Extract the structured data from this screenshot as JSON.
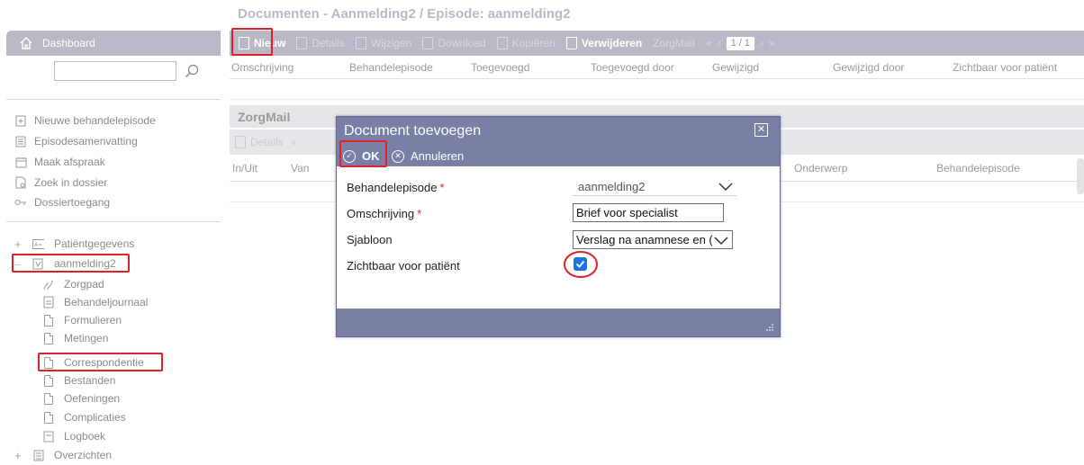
{
  "sidebar": {
    "dashboard_label": "Dashboard",
    "search_value": "",
    "actions": [
      {
        "label": "Nieuwe behandelepisode",
        "icon": "new-episode-icon"
      },
      {
        "label": "Episodesamenvatting",
        "icon": "summary-icon"
      },
      {
        "label": "Maak afspraak",
        "icon": "calendar-icon"
      },
      {
        "label": "Zoek in dossier",
        "icon": "search-document-icon"
      },
      {
        "label": "Dossiertoegang",
        "icon": "key-icon"
      }
    ],
    "tree": {
      "patient_data": "Patiëntgegevens",
      "episode": "aanmelding2",
      "episode_items": [
        "Zorgpad",
        "Behandeljournaal",
        "Formulieren",
        "Metingen",
        "Correspondentie",
        "Bestanden",
        "Oefeningen",
        "Complicaties",
        "Logboek"
      ],
      "overviews": "Overzichten"
    }
  },
  "main": {
    "title": "Documenten - Aanmelding2 / Episode: aanmelding2",
    "toolbar": {
      "new": "Nieuw",
      "details": "Details",
      "edit": "Wijzigen",
      "download": "Download",
      "copy": "Kopiëren",
      "delete": "Verwijderen",
      "zorgmail": "ZorgMail",
      "pager": "1 / 1"
    },
    "columns": [
      "Omschrijving",
      "Behandelepisode",
      "Toegevoegd",
      "Toegevoegd door",
      "Gewijzigd",
      "Gewijzigd door",
      "Zichtbaar voor patiënt"
    ]
  },
  "zorgmail": {
    "title": "ZorgMail",
    "details": "Details",
    "columns": [
      "In/Uit",
      "Van",
      "Onderwerp",
      "Behandelepisode"
    ]
  },
  "dialog": {
    "title": "Document toevoegen",
    "ok": "OK",
    "cancel": "Annuleren",
    "fields": {
      "episode_label": "Behandelepisode",
      "episode_value": "aanmelding2",
      "description_label": "Omschrijving",
      "description_value": "Brief voor specialist",
      "template_label": "Sjabloon",
      "template_value": "Verslag na anamnese en (",
      "visible_label": "Zichtbaar voor patiënt",
      "visible_checked": true
    }
  },
  "colors": {
    "highlight": "#e0202a",
    "toolbar_bg": "#b9b9c6",
    "dialog_header": "#7a7fa6",
    "checkbox": "#1a73e8"
  }
}
